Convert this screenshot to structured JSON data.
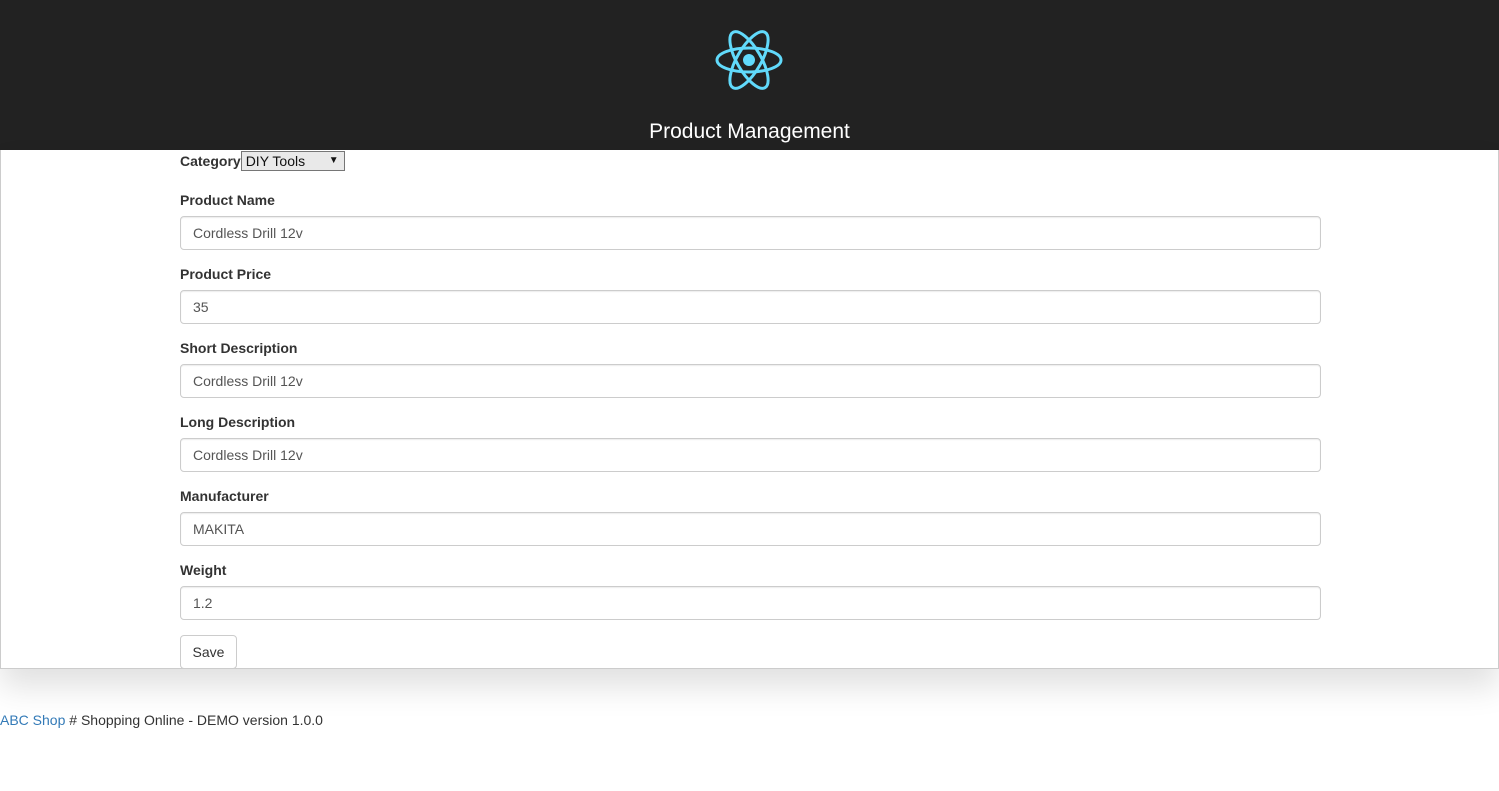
{
  "header": {
    "title": "Product Management",
    "logo_icon": "react-atom-icon",
    "logo_color": "#61dafb",
    "background": "#222222"
  },
  "form": {
    "category": {
      "label": "Category",
      "selected": "DIY Tools"
    },
    "fields": [
      {
        "label": "Product Name",
        "value": "Cordless Drill 12v"
      },
      {
        "label": "Product Price",
        "value": "35"
      },
      {
        "label": "Short Description",
        "value": "Cordless Drill 12v"
      },
      {
        "label": "Long Description",
        "value": "Cordless Drill 12v"
      },
      {
        "label": "Manufacturer",
        "value": "MAKITA"
      },
      {
        "label": "Weight",
        "value": "1.2"
      }
    ],
    "save_label": "Save"
  },
  "footer": {
    "link_text": "ABC Shop",
    "text": " # Shopping Online - DEMO version 1.0.0",
    "link_color": "#337ab7"
  }
}
